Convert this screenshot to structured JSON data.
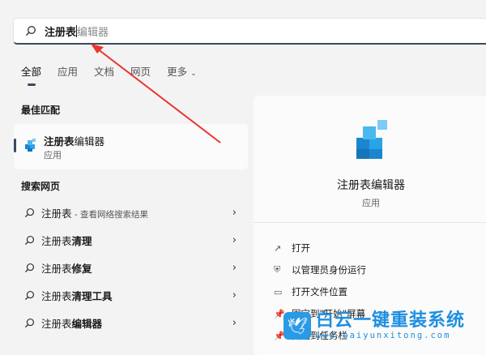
{
  "search": {
    "typed": "注册表",
    "suggestion": "编辑器"
  },
  "tabs": [
    "全部",
    "应用",
    "文档",
    "网页",
    "更多"
  ],
  "best_match": {
    "heading": "最佳匹配",
    "title_bold": "注册表",
    "title_rest": "编辑器",
    "subtitle": "应用"
  },
  "web": {
    "heading": "搜索网页",
    "items": [
      {
        "bold": "注册表",
        "rest": "",
        "sub": " - 查看网络搜索结果"
      },
      {
        "bold": "注册表",
        "rest": "清理",
        "sub": ""
      },
      {
        "bold": "注册表",
        "rest": "修复",
        "sub": ""
      },
      {
        "bold": "注册表",
        "rest": "清理工具",
        "sub": ""
      },
      {
        "bold": "注册表",
        "rest": "编辑器",
        "sub": ""
      }
    ]
  },
  "panel": {
    "name": "注册表编辑器",
    "kind": "应用",
    "actions": [
      "打开",
      "以管理员身份运行",
      "打开文件位置",
      "固定到\"开始\"屏幕",
      "固定到任务栏"
    ]
  },
  "watermark": {
    "name": "白云一键重装系统",
    "url": "www.baiyunxitong.com"
  },
  "colors": {
    "accent": "#3b4a5e",
    "arrow": "#e8362f",
    "watermark": "#1e8fe0"
  }
}
